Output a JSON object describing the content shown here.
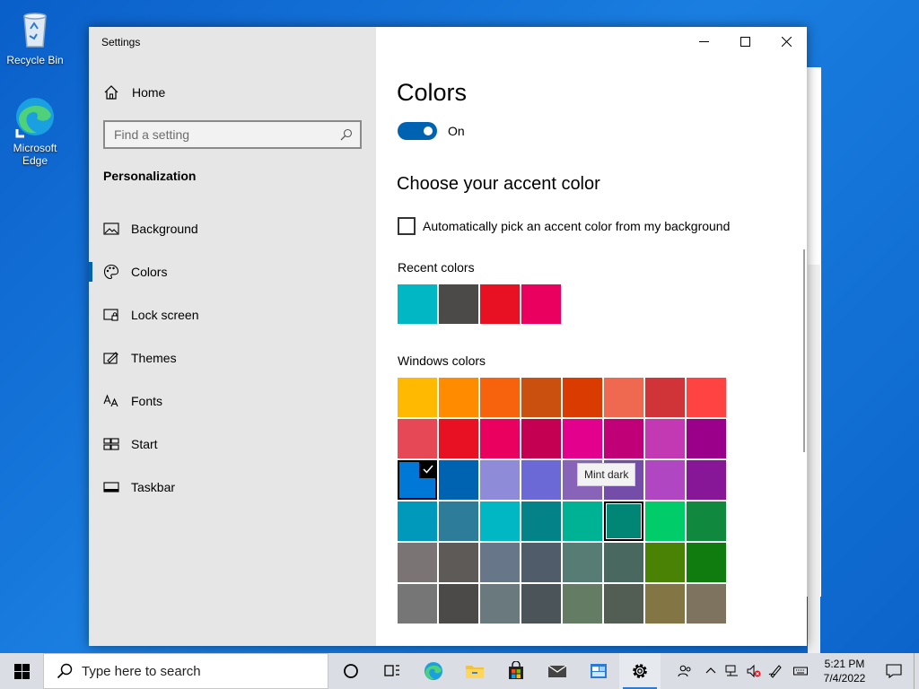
{
  "desktop": {
    "icons": [
      {
        "label": "Recycle Bin",
        "icon": "recycle-bin-icon"
      },
      {
        "label": "Microsoft Edge",
        "icon": "edge-icon"
      }
    ]
  },
  "window": {
    "title": "Settings",
    "controls": {
      "minimize": "minimize-icon",
      "maximize": "maximize-icon",
      "close": "close-icon"
    }
  },
  "sidebar": {
    "home_label": "Home",
    "search_placeholder": "Find a setting",
    "section_label": "Personalization",
    "items": [
      {
        "label": "Background",
        "icon": "picture-icon",
        "selected": false
      },
      {
        "label": "Colors",
        "icon": "palette-icon",
        "selected": true
      },
      {
        "label": "Lock screen",
        "icon": "lock-screen-icon",
        "selected": false
      },
      {
        "label": "Themes",
        "icon": "themes-icon",
        "selected": false
      },
      {
        "label": "Fonts",
        "icon": "fonts-icon",
        "selected": false
      },
      {
        "label": "Start",
        "icon": "start-icon",
        "selected": false
      },
      {
        "label": "Taskbar",
        "icon": "taskbar-icon",
        "selected": false
      }
    ]
  },
  "main": {
    "title": "Colors",
    "toggle_label": "On",
    "toggle_on": true,
    "accent_heading": "Choose your accent color",
    "auto_pick_label": "Automatically pick an accent color from my background",
    "auto_pick_checked": false,
    "recent_label": "Recent colors",
    "recent_colors": [
      "#00b7c3",
      "#4c4a48",
      "#e81123",
      "#ea005e"
    ],
    "windows_label": "Windows colors",
    "windows_colors": [
      "#ffb900",
      "#ff8c00",
      "#f7630c",
      "#ca5010",
      "#da3b01",
      "#ef6950",
      "#d13438",
      "#ff4343",
      "#e74856",
      "#e81123",
      "#ea005e",
      "#c30052",
      "#e3008c",
      "#bf0077",
      "#c239b3",
      "#9a0089",
      "#0078d7",
      "#0063b1",
      "#8e8cd8",
      "#6b69d6",
      "#8764b8",
      "#744da9",
      "#b146c2",
      "#881798",
      "#0099bc",
      "#2d7d9a",
      "#00b7c3",
      "#038387",
      "#00b294",
      "#018574",
      "#00cc6a",
      "#10893e",
      "#7a7574",
      "#5d5a58",
      "#68768a",
      "#515c6b",
      "#567c73",
      "#486860",
      "#498205",
      "#107c10",
      "#767676",
      "#4c4a48",
      "#69797e",
      "#4a5459",
      "#647c64",
      "#525e54",
      "#847545",
      "#7e735f"
    ],
    "selected_color_index": 16,
    "hovered_color_index": 29,
    "tooltip": "Mint dark"
  },
  "taskbar": {
    "search_placeholder": "Type here to search",
    "apps": [
      {
        "name": "task-view-icon"
      },
      {
        "name": "timeline-icon"
      },
      {
        "name": "edge-icon"
      },
      {
        "name": "file-explorer-icon"
      },
      {
        "name": "store-icon"
      },
      {
        "name": "mail-icon"
      },
      {
        "name": "photos-icon"
      },
      {
        "name": "settings-gear-icon"
      }
    ],
    "clock_time": "5:21 PM",
    "clock_date": "7/4/2022"
  }
}
